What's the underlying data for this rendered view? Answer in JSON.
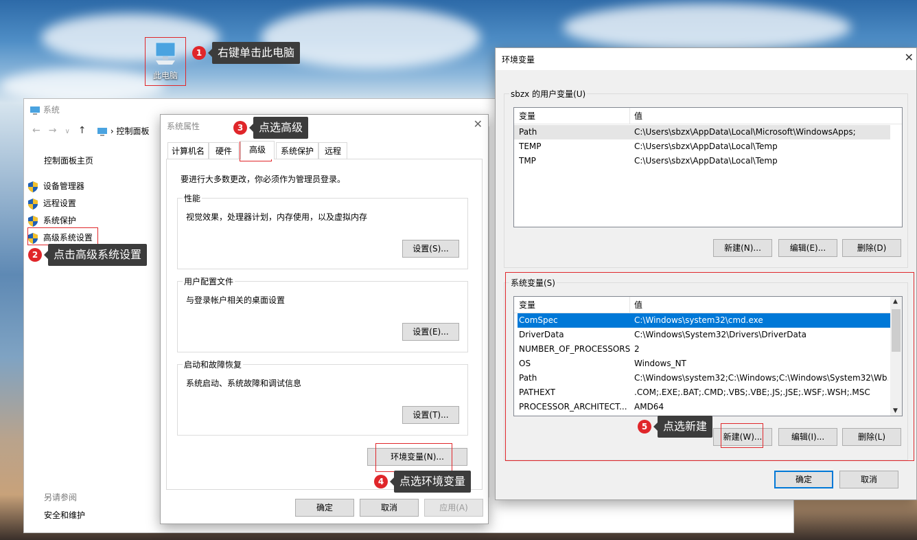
{
  "desktop": {
    "this_pc_label": "此电脑"
  },
  "callouts": [
    {
      "num": "1",
      "text": "右键单击此电脑"
    },
    {
      "num": "2",
      "text": "点击高级系统设置"
    },
    {
      "num": "3",
      "text": "点选高级"
    },
    {
      "num": "4",
      "text": "点选环境变量"
    },
    {
      "num": "5",
      "text": "点选新建"
    }
  ],
  "system_window": {
    "title": "系统",
    "breadcrumb": "控制面板",
    "home_link": "控制面板主页",
    "side_items": [
      "设备管理器",
      "远程设置",
      "系统保护",
      "高级系统设置"
    ],
    "see_also_label": "另请参阅",
    "see_also_link": "安全和维护"
  },
  "sysprops": {
    "title": "系统属性",
    "tabs": [
      "计算机名",
      "硬件",
      "高级",
      "系统保护",
      "远程"
    ],
    "admin_note": "要进行大多数更改，你必须作为管理员登录。",
    "perf": {
      "title": "性能",
      "desc": "视觉效果，处理器计划，内存使用，以及虚拟内存",
      "btn": "设置(S)..."
    },
    "profile": {
      "title": "用户配置文件",
      "desc": "与登录帐户相关的桌面设置",
      "btn": "设置(E)..."
    },
    "startup": {
      "title": "启动和故障恢复",
      "desc": "系统启动、系统故障和调试信息",
      "btn": "设置(T)..."
    },
    "env_btn": "环境变量(N)...",
    "ok": "确定",
    "cancel": "取消",
    "apply": "应用(A)"
  },
  "envvars": {
    "title": "环境变量",
    "user_group": "sbzx 的用户变量(U)",
    "col_var": "变量",
    "col_val": "值",
    "user_vars": [
      {
        "name": "Path",
        "value": "C:\\Users\\sbzx\\AppData\\Local\\Microsoft\\WindowsApps;"
      },
      {
        "name": "TEMP",
        "value": "C:\\Users\\sbzx\\AppData\\Local\\Temp"
      },
      {
        "name": "TMP",
        "value": "C:\\Users\\sbzx\\AppData\\Local\\Temp"
      }
    ],
    "user_new": "新建(N)...",
    "user_edit": "编辑(E)...",
    "user_delete": "删除(D)",
    "sys_group": "系统变量(S)",
    "sys_vars": [
      {
        "name": "ComSpec",
        "value": "C:\\Windows\\system32\\cmd.exe"
      },
      {
        "name": "DriverData",
        "value": "C:\\Windows\\System32\\Drivers\\DriverData"
      },
      {
        "name": "NUMBER_OF_PROCESSORS",
        "value": "2"
      },
      {
        "name": "OS",
        "value": "Windows_NT"
      },
      {
        "name": "Path",
        "value": "C:\\Windows\\system32;C:\\Windows;C:\\Windows\\System32\\Wb..."
      },
      {
        "name": "PATHEXT",
        "value": ".COM;.EXE;.BAT;.CMD;.VBS;.VBE;.JS;.JSE;.WSF;.WSH;.MSC"
      },
      {
        "name": "PROCESSOR_ARCHITECT...",
        "value": "AMD64"
      }
    ],
    "sys_new": "新建(W)...",
    "sys_edit": "编辑(I)...",
    "sys_delete": "删除(L)",
    "ok": "确定",
    "cancel": "取消"
  }
}
